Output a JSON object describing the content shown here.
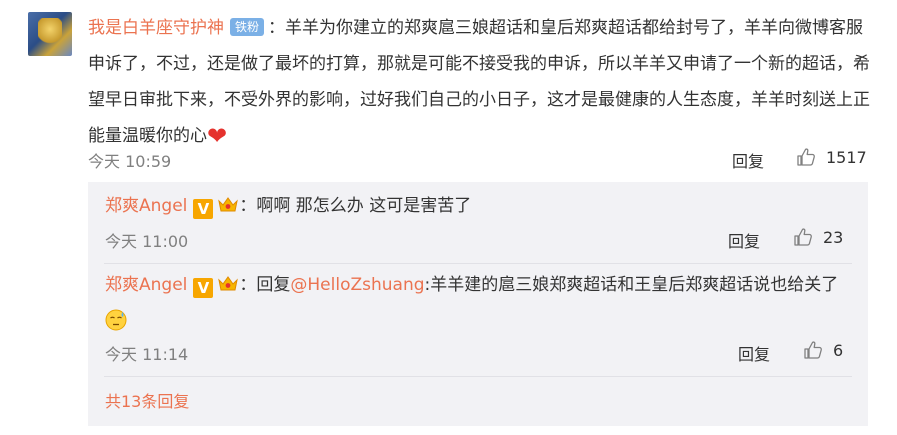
{
  "comment": {
    "username": "我是白羊座守护神",
    "badge": "铁粉",
    "separator": "：",
    "text": "羊羊为你建立的郑爽扈三娘超话和皇后郑爽超话都给封号了，羊羊向微博客服申诉了，不过，还是做了最坏的打算，那就是可能不接受我的申诉，所以羊羊又申请了一个新的超话，希望早日审批下来，不受外界的影响，过好我们自己的小日子，这才是最健康的人生态度，羊羊时刻送上正能量温暖你的心",
    "emoji": "❤",
    "time": "今天 10:59",
    "reply_label": "回复",
    "likes": "1517"
  },
  "replies": [
    {
      "username": "郑爽Angel",
      "verified_mark": "V",
      "separator": "：",
      "text": "啊啊 那怎么办 这可是害苦了",
      "time": "今天 11:00",
      "reply_label": "回复",
      "likes": "23"
    },
    {
      "username": "郑爽Angel",
      "verified_mark": "V",
      "separator": "：",
      "reply_prefix": "回复",
      "mention": "@HelloZshuang",
      "text": ":羊羊建的扈三娘郑爽超话和王皇后郑爽超话说也给关了",
      "time": "今天 11:14",
      "reply_label": "回复",
      "likes": "6"
    }
  ],
  "total_replies": "共13条回复",
  "colors": {
    "link": "#eb7350",
    "badge": "#7bb0e6",
    "verified": "#f7a600",
    "reply_bg": "#f2f2f5"
  }
}
